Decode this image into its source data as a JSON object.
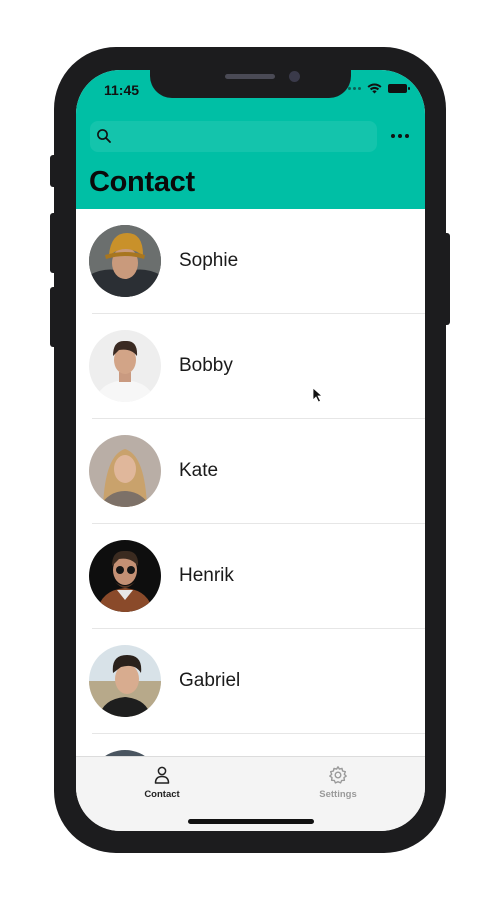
{
  "status_bar": {
    "time": "11:45"
  },
  "header": {
    "title": "Contact",
    "search_icon": "search-icon",
    "more_icon": "more-horizontal-icon",
    "accent_color": "#00bfa5"
  },
  "contacts": [
    {
      "name": "Sophie"
    },
    {
      "name": "Bobby"
    },
    {
      "name": "Kate"
    },
    {
      "name": "Henrik"
    },
    {
      "name": "Gabriel"
    }
  ],
  "tab_bar": {
    "tabs": [
      {
        "label": "Contact",
        "icon": "person-icon",
        "active": true
      },
      {
        "label": "Settings",
        "icon": "gear-icon",
        "active": false
      }
    ]
  }
}
